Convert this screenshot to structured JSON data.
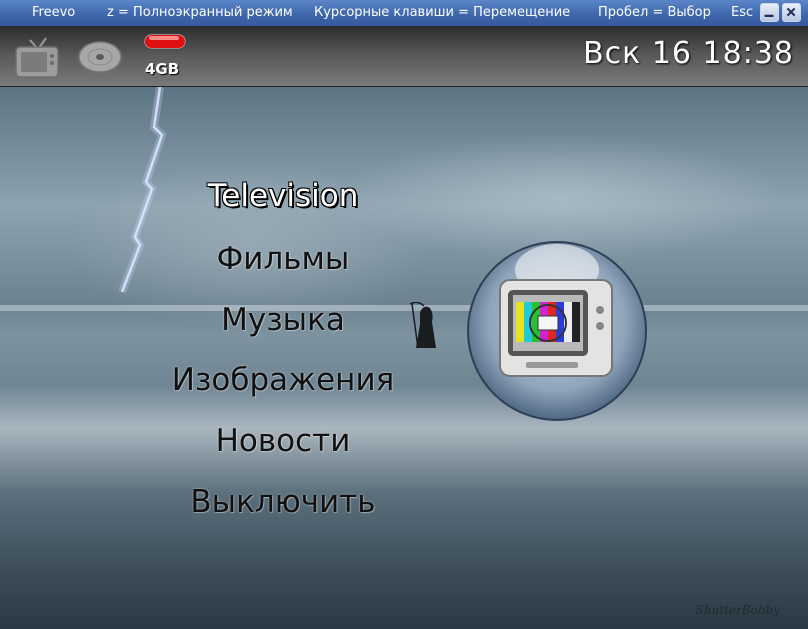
{
  "window": {
    "title": "Freevo",
    "hints": [
      "z = Полноэкранный режим",
      "Курсорные клавиши = Перемещение",
      "Пробел = Выбор",
      "Esc"
    ]
  },
  "statusbar": {
    "icons": [
      "tv-icon",
      "disc-icon",
      "disk-usage-icon"
    ],
    "disk_label": "4GB",
    "clock": "Вск 16 18:38"
  },
  "menu": {
    "items": [
      {
        "label": "Television",
        "selected": true
      },
      {
        "label": "Фильмы",
        "selected": false
      },
      {
        "label": "Музыка",
        "selected": false
      },
      {
        "label": "Изображения",
        "selected": false
      },
      {
        "label": "Новости",
        "selected": false
      },
      {
        "label": "Выключить",
        "selected": false
      }
    ]
  },
  "preview": {
    "icon": "television-test-card-icon"
  },
  "watermark": "ShutterBobby",
  "colors": {
    "titlebar": "#3f67ad",
    "selected_text": "#ffffff",
    "menu_text": "#111111",
    "disk_indicator": "#e01010"
  }
}
